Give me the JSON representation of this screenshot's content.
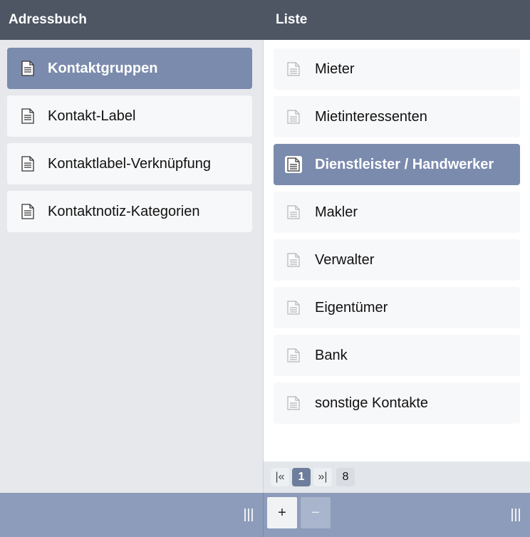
{
  "left_panel": {
    "title": "Adressbuch",
    "items": [
      {
        "label": "Kontaktgruppen",
        "selected": true
      },
      {
        "label": "Kontakt-Label",
        "selected": false
      },
      {
        "label": "Kontaktlabel-Verknüpfung",
        "selected": false
      },
      {
        "label": "Kontaktnotiz-Kategorien",
        "selected": false
      }
    ]
  },
  "right_panel": {
    "title": "Liste",
    "items": [
      {
        "label": "Mieter",
        "selected": false
      },
      {
        "label": "Mietinteressenten",
        "selected": false
      },
      {
        "label": "Dienstleister / Handwerker",
        "selected": true
      },
      {
        "label": "Makler",
        "selected": false
      },
      {
        "label": "Verwalter",
        "selected": false
      },
      {
        "label": "Eigentümer",
        "selected": false
      },
      {
        "label": "Bank",
        "selected": false
      },
      {
        "label": "sonstige Kontakte",
        "selected": false
      }
    ]
  },
  "pagination": {
    "first_label": "|«",
    "current_page": "1",
    "last_label": "»|",
    "total_count": "8"
  },
  "footer": {
    "add_label": "+",
    "remove_label": "−"
  },
  "icons": {
    "item_icon": "document-icon",
    "resize_handle": "grip-handle-icon"
  },
  "colors": {
    "header": "#4e5563",
    "selected": "#7b8bad",
    "footer": "#8d9cba"
  }
}
